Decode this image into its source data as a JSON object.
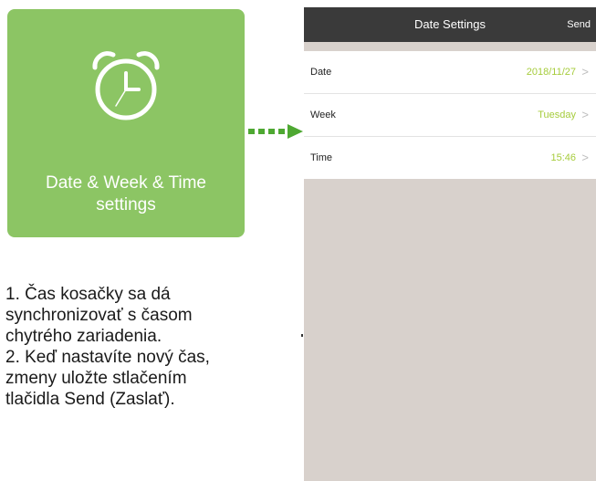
{
  "tile": {
    "label_line1": "Date & Week & Time",
    "label_line2": "settings",
    "icon": "alarm-clock-icon"
  },
  "arrow": {
    "icon": "dashed-arrow-right-icon",
    "color": "#4ea832"
  },
  "instructions": {
    "lines": [
      "1. Čas kosačky sa dá",
      "synchronizovať s časom",
      "chytrého zariadenia.",
      "2. Keď nastavíte nový čas,",
      "zmeny uložte stlačením",
      "tlačidla Send (Zaslať)."
    ]
  },
  "phone": {
    "title": "Date Settings",
    "send_label": "Send",
    "rows": [
      {
        "label": "Date",
        "value": "2018/11/27"
      },
      {
        "label": "Week",
        "value": "Tuesday"
      },
      {
        "label": "Time",
        "value": "15:46"
      }
    ],
    "chevron": ">"
  },
  "colors": {
    "tile": "#8cc564",
    "navbar": "#3a3a3a",
    "value": "#a6cc3c",
    "phone_bg": "#d8d1cc"
  }
}
